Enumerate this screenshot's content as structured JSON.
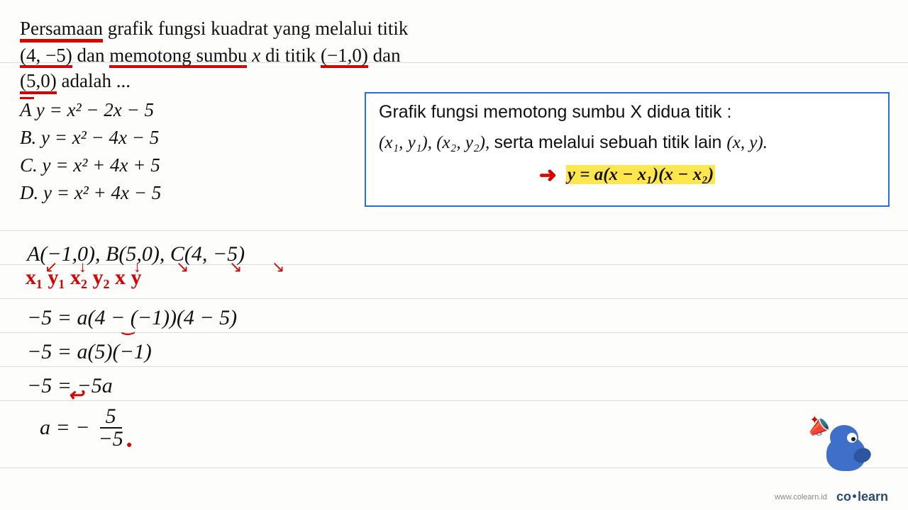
{
  "question": {
    "line1_a": "Persamaan",
    "line1_b": "grafik fungsi kuadrat yang melalui titik",
    "point1": "(4, −5)",
    "mid2": " dan ",
    "phrase2": "memotong sumbu",
    "var_x": " x ",
    "mid3": "di titik ",
    "point2": "(−1,0)",
    "mid4": " dan",
    "point3": "(5,0)",
    "mid5": " adalah ..."
  },
  "options": {
    "a": "A y = x² − 2x − 5",
    "b": "B. y = x²  −  4x − 5",
    "c": "C. y = x² + 4x  +  5",
    "d": "D. y = x² +  4x  −  5"
  },
  "box": {
    "line1": "Grafik fungsi memotong sumbu X didua titik :",
    "line2_a": "(x₁, y₁), (x₂, y₂), ",
    "line2_b": "serta melalui sebuah titik lain ",
    "line2_c": "(x, y).",
    "formula": "y = a(x − x₁)(x − x₂)"
  },
  "work": {
    "points": "A(−1,0), B(5,0), C(4, −5)",
    "labels": "x₁   y₁    x₂    y₂    x    y",
    "step1": "−5 = a(4 − (−1))(4 − 5)",
    "step2": "−5 = a(5)(−1)",
    "step3": "−5 = −5a",
    "step4_lhs": "a = −",
    "step4_num": "5",
    "step4_den": "−5"
  },
  "footer": {
    "url": "www.colearn.id",
    "brand_a": "co",
    "brand_b": "learn"
  }
}
